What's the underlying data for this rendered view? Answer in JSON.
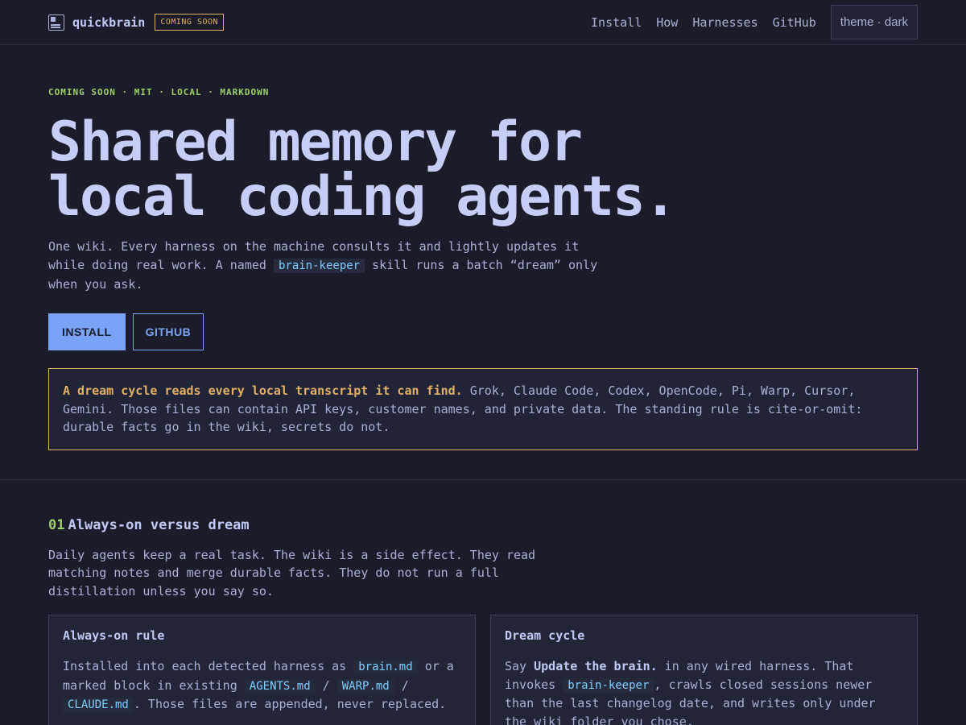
{
  "nav": {
    "brand": "quickbrain",
    "badge": "COMING SOON",
    "links": [
      "Install",
      "How",
      "Harnesses",
      "GitHub"
    ],
    "theme_toggle": "theme · dark"
  },
  "hero": {
    "eyebrow": "COMING SOON · MIT · LOCAL · MARKDOWN",
    "headline_line1": "Shared memory for",
    "headline_line2": "local coding agents.",
    "lede_part1": "One wiki. Every harness on the machine consults it and lightly updates it while doing real work. A named ",
    "lede_code": "brain-keeper",
    "lede_part2": " skill runs a batch “dream” only when you ask.",
    "install_label": "INSTALL",
    "github_label": "GITHUB",
    "warning_strong": "A dream cycle reads every local transcript it can find.",
    "warning_text": " Grok, Claude Code, Codex, OpenCode, Pi, Warp, Cursor, Gemini. Those files can contain API keys, customer names, and private data. The standing rule is cite-or-omit: durable facts go in the wiki, secrets do not."
  },
  "section": {
    "number": "01",
    "title": "Always-on versus dream",
    "description": "Daily agents keep a real task. The wiki is a side effect. They read matching notes and merge durable facts. They do not run a full distillation unless you say so.",
    "cards": [
      {
        "title": "Always-on rule",
        "t1": "Installed into each detected harness as ",
        "c1": "brain.md",
        "t2": " or a marked block in existing ",
        "c2": "AGENTS.md",
        "t3": " / ",
        "c3": "WARP.md",
        "t4": " / ",
        "c4": "CLAUDE.md",
        "t5": ". Those files are appended, never replaced."
      },
      {
        "title": "Dream cycle",
        "t1": "Say ",
        "s1": "Update the brain.",
        "t2": " in any wired harness. That invokes ",
        "c1": "brain-keeper",
        "t3": ", crawls closed sessions newer than the last changelog date, and writes only under the wiki folder you chose."
      }
    ]
  }
}
